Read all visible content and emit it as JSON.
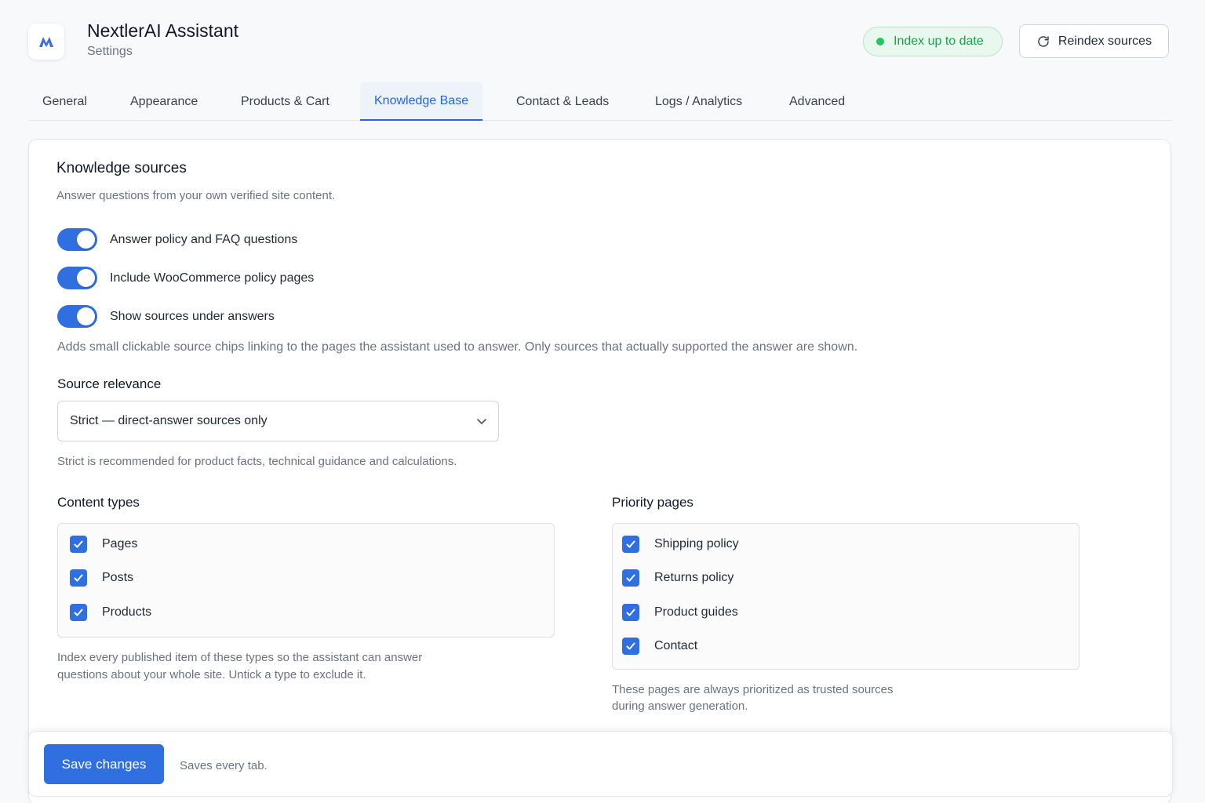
{
  "header": {
    "title": "NextlerAI Assistant",
    "subtitle": "Settings",
    "logo_icon": "nextler-logo-icon",
    "status": "Index up to date",
    "status_color": "#22c55e",
    "reindex_label": "Reindex sources",
    "reindex_icon": "refresh-icon"
  },
  "tabs": [
    {
      "label": "General",
      "active": false
    },
    {
      "label": "Appearance",
      "active": false
    },
    {
      "label": "Products & Cart",
      "active": false
    },
    {
      "label": "Knowledge Base",
      "active": true
    },
    {
      "label": "Contact & Leads",
      "active": false
    },
    {
      "label": "Logs / Analytics",
      "active": false
    },
    {
      "label": "Advanced",
      "active": false
    }
  ],
  "knowledge": {
    "title": "Knowledge sources",
    "description": "Answer questions from your own verified site content.",
    "toggles": [
      {
        "label": "Answer policy and FAQ questions",
        "on": true
      },
      {
        "label": "Include WooCommerce policy pages",
        "on": true
      },
      {
        "label": "Show sources under answers",
        "on": true
      }
    ],
    "sources_help": "Adds small clickable source chips linking to the pages the assistant used to answer. Only sources that actually supported the answer are shown."
  },
  "relevance": {
    "label": "Source relevance",
    "value": "Strict — direct-answer sources only",
    "help": "Strict is recommended for product facts, technical guidance and calculations."
  },
  "content_types": {
    "label": "Content types",
    "items": [
      {
        "label": "Pages",
        "checked": true
      },
      {
        "label": "Posts",
        "checked": true
      },
      {
        "label": "Products",
        "checked": true
      }
    ],
    "help_line1": "Index every published item of these types so the assistant can answer",
    "help_line2": "questions about your whole site. Untick a type to exclude it."
  },
  "priority_pages": {
    "label": "Priority pages",
    "items": [
      {
        "label": "Shipping policy",
        "checked": true
      },
      {
        "label": "Returns policy",
        "checked": true
      },
      {
        "label": "Product guides",
        "checked": true
      },
      {
        "label": "Contact",
        "checked": true
      }
    ],
    "help_line1": "These pages are always prioritized as trusted sources",
    "help_line2": "during answer generation."
  },
  "footer": {
    "save_label": "Save changes",
    "hint": "Saves every tab."
  },
  "colors": {
    "accent": "#2f6fe0",
    "success": "#22c55e"
  }
}
